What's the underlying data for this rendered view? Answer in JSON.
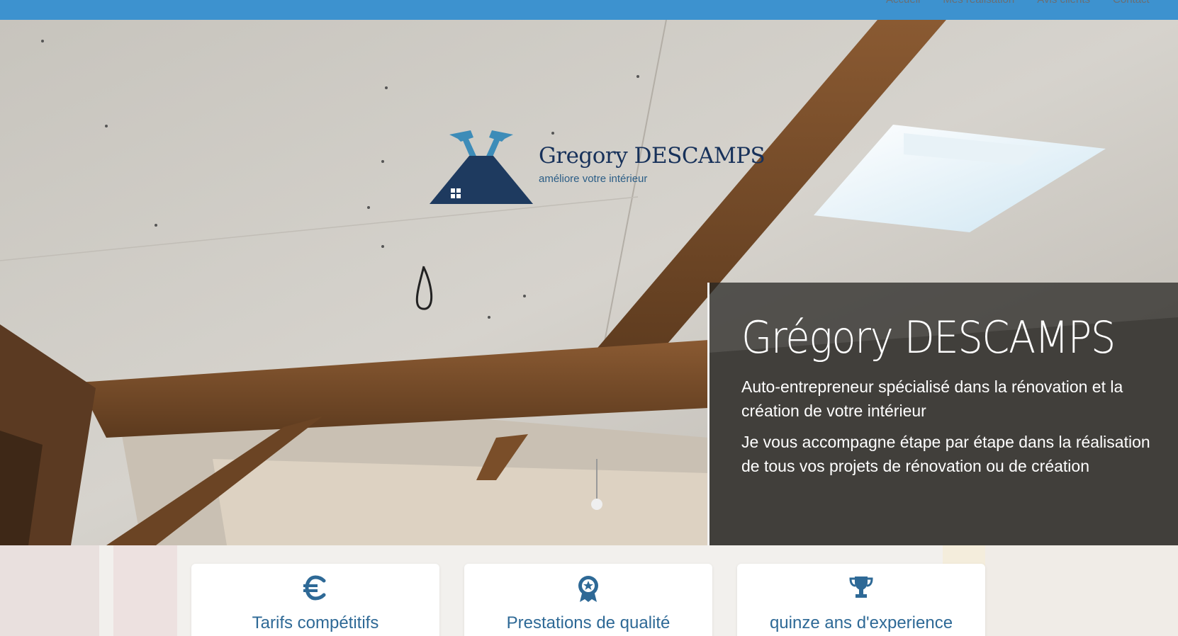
{
  "nav": {
    "items": [
      "Accueil",
      "Mes réalisation",
      "Avis clients",
      "Contact"
    ]
  },
  "logo": {
    "title": "Gregory DESCAMPS",
    "tagline": "améliore votre intérieur"
  },
  "intro": {
    "name": "Grégory DESCAMPS",
    "line1": "Auto-entrepreneur spécialisé dans la rénovation et la création de votre intérieur",
    "line2": "Je vous accompagne étape par étape dans la réalisation de tous vos projets de rénovation ou de création"
  },
  "features": [
    {
      "icon": "euro-icon",
      "label": "Tarifs compétitifs"
    },
    {
      "icon": "award-badge-icon",
      "label": "Prestations de qualité"
    },
    {
      "icon": "trophy-icon",
      "label": "quinze ans d'experience"
    }
  ],
  "colors": {
    "nav_bar": "#3d92cf",
    "logo_navy": "#1e3a5f",
    "logo_blue": "#3d8cb8",
    "feature_blue": "#2e6996"
  }
}
